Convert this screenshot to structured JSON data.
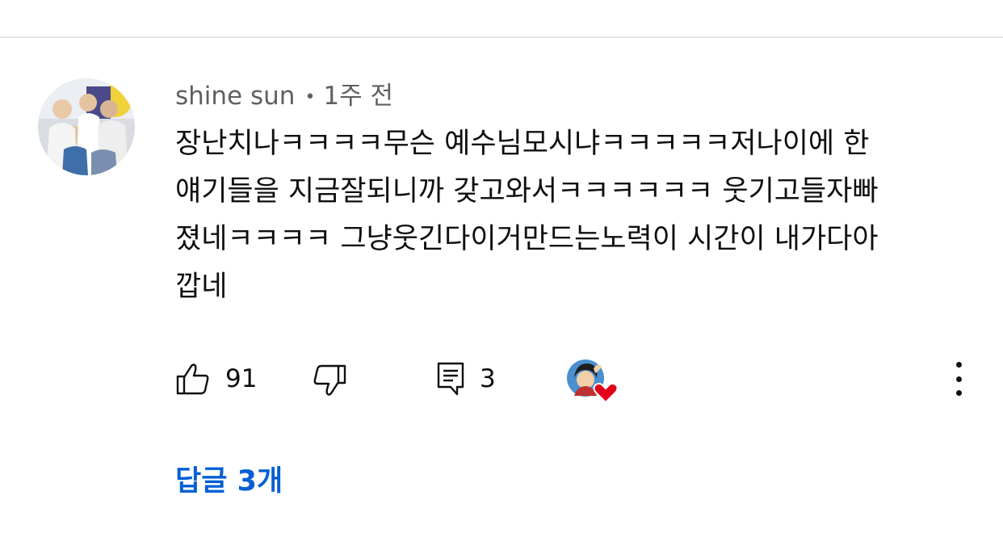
{
  "comment": {
    "author": "shine sun",
    "separator": "•",
    "time_ago": "1주 전",
    "text_lines": [
      "장난치나ㅋㅋㅋㅋ무슨 예수님모시냐ㅋㅋㅋㅋㅋ저나이에 한",
      "얘기들을 지금잘되니까 갖고와서ㅋㅋㅋㅋㅋㅋ 웃기고들자빠",
      "졌네ㅋㅋㅋㅋ 그냥웃긴다이거만드는노력이 시간이 내가다아",
      "깝네"
    ]
  },
  "actions": {
    "like_icon": "thumbs-up-icon",
    "like_count": "91",
    "dislike_icon": "thumbs-down-icon",
    "reply_icon": "comment-reply-icon",
    "reply_count": "3",
    "creator_heart_icon": "creator-heart-icon",
    "more_icon": "more-vertical-icon"
  },
  "replies": {
    "label": "답글 3개"
  },
  "colors": {
    "link": "#065fd4",
    "text": "#0f0f0f",
    "meta": "#606060",
    "heart": "#e2001a"
  }
}
